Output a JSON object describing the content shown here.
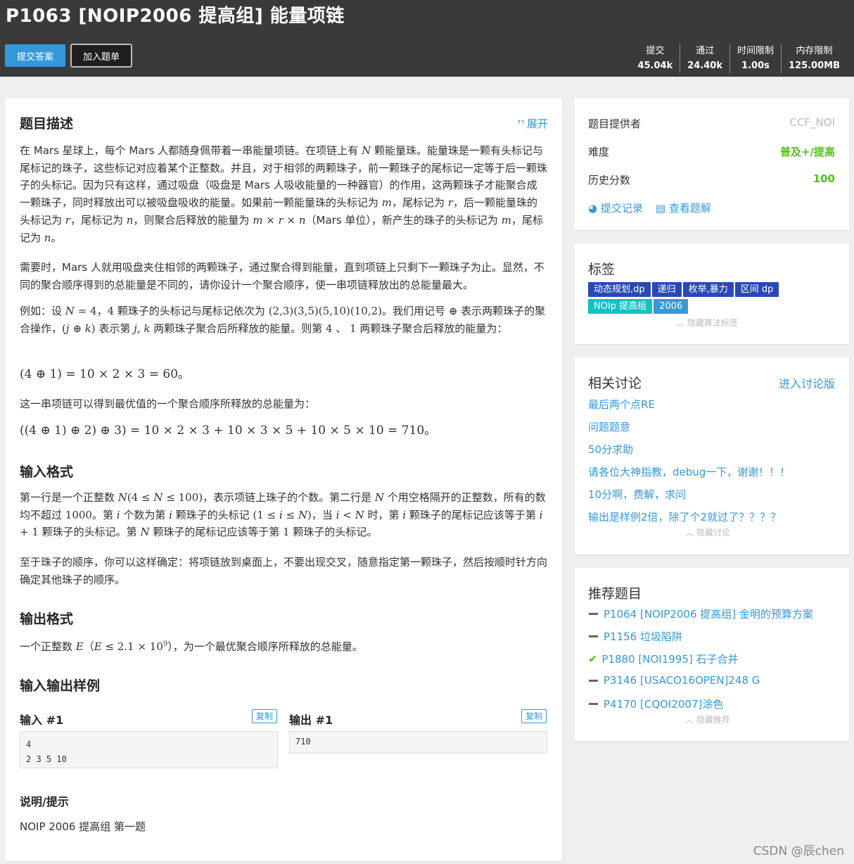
{
  "header": {
    "title": "P1063 [NOIP2006 提高组] 能量项链",
    "submit_label": "提交答案",
    "add_label": "加入题单",
    "stats": [
      {
        "label": "提交",
        "value": "45.04k"
      },
      {
        "label": "通过",
        "value": "24.40k"
      },
      {
        "label": "时间限制",
        "value": "1.00s"
      },
      {
        "label": "内存限制",
        "value": "125.00MB"
      }
    ]
  },
  "main": {
    "expand_label": "展开",
    "desc_title": "题目描述",
    "input_title": "输入格式",
    "output_title": "输出格式",
    "samples_title": "输入输出样例",
    "input_label": "输入 #1",
    "output_label": "输出 #1",
    "copy_label": "复制",
    "sample_input": "4\n2 3 5 10",
    "sample_output": "710",
    "hint_title": "说明/提示",
    "hint_text": "NOIP 2006 提高组 第一题"
  },
  "info": {
    "provider_label": "题目提供者",
    "provider": "CCF_NOI",
    "difficulty_label": "难度",
    "difficulty": "普及+/提高",
    "difficulty_color": "#52c41a",
    "score_label": "历史分数",
    "score": "100",
    "records_label": "提交记录",
    "solutions_label": "查看题解"
  },
  "tags": {
    "title": "标签",
    "items": [
      {
        "label": "动态规划,dp",
        "color": "#2949b4"
      },
      {
        "label": "递归",
        "color": "#2949b4"
      },
      {
        "label": "枚举,暴力",
        "color": "#2949b4"
      },
      {
        "label": "区间 dp",
        "color": "#2949b4"
      },
      {
        "label": "NOIp 提高组",
        "color": "#13c2c2"
      },
      {
        "label": "2006",
        "color": "#3498db"
      }
    ],
    "hide_label": "隐藏算法标签"
  },
  "discuss": {
    "title": "相关讨论",
    "enter_label": "进入讨论版",
    "items": [
      "最后两个点RE",
      "问题题意",
      "50分求助",
      "请各位大神指教，debug一下，谢谢！！！",
      "10分啊，费解，求问",
      "输出是样例2倍，除了个2就过了？？？？"
    ],
    "hide_label": "隐藏讨论"
  },
  "recommend": {
    "title": "推荐题目",
    "items": [
      {
        "label": "P1064 [NOIP2006 提高组] 金明的预算方案",
        "status": "dash"
      },
      {
        "label": "P1156 垃圾陷阱",
        "status": "dash"
      },
      {
        "label": "P1880 [NOI1995] 石子合并",
        "status": "check"
      },
      {
        "label": "P3146 [USACO16OPEN]248 G",
        "status": "dash"
      },
      {
        "label": "P4170 [CQOI2007]涂色",
        "status": "dash"
      }
    ],
    "hide_label": "隐藏推荐"
  },
  "watermark": "CSDN @辰chen"
}
